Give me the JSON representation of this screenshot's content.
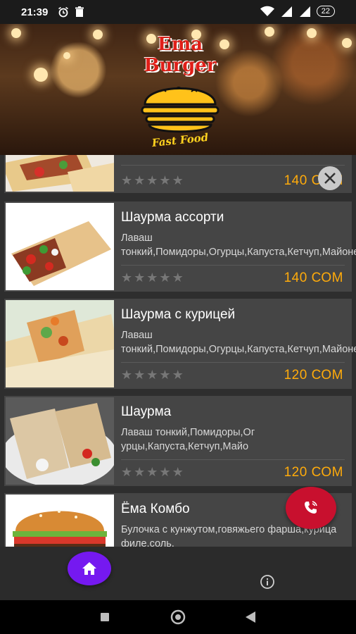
{
  "status_bar": {
    "time": "21:39",
    "battery": "22",
    "icons": [
      "alarm-icon",
      "trash-icon",
      "wifi-icon",
      "signal-icon",
      "signal-icon",
      "battery-icon"
    ]
  },
  "header": {
    "logo_line1": "Ema",
    "logo_line2": "Burger",
    "logo_tagline": "Fast Food"
  },
  "menu": {
    "items": [
      {
        "title": "",
        "description": "",
        "price": "140 СОМ",
        "rating": 0,
        "image": "shawarma-rolls"
      },
      {
        "title": "Шаурма ассорти",
        "description": "Лаваш тонкий,Помидоры,Огурцы,Капуста,Кетчуп,Майонез,Куриное",
        "price": "140 СОМ",
        "rating": 0,
        "image": "shawarma-assorti"
      },
      {
        "title": "Шаурма с курицей",
        "description": "Лаваш тонкий,Помидоры,Огурцы,Капуста,Кетчуп,Майонез,Куриное",
        "price": "120 СОМ",
        "rating": 0,
        "image": "shawarma-chicken"
      },
      {
        "title": "Шаурма",
        "description": "Лаваш тонкий,Помидоры,Ог урцы,Капуста,Кетчуп,Майо",
        "price": "120 СОМ",
        "rating": 0,
        "image": "shawarma"
      },
      {
        "title": "Ёма Комбо",
        "description": "Булочка с кунжутом,говяжьего фарша,курица филе,соль,",
        "price": "",
        "rating": 0,
        "image": "burger"
      }
    ]
  },
  "fab": {
    "close_icon": "close-icon",
    "call_icon": "phone-call-icon",
    "home_icon": "home-icon",
    "info_icon": "info-icon"
  },
  "colors": {
    "price": "#ffab0b",
    "call_button": "#c8102e",
    "home_button": "#7519f0",
    "card_bg": "#454545",
    "screen_bg": "#2e2e2e"
  }
}
